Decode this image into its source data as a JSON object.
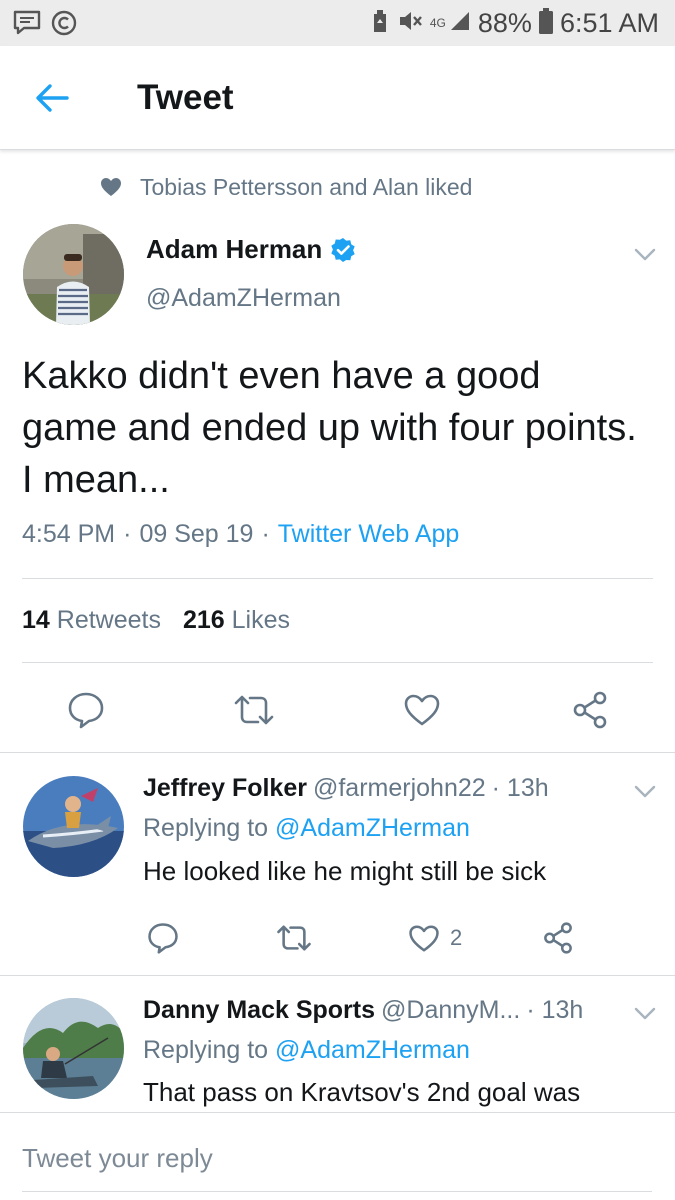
{
  "status_bar": {
    "battery": "88%",
    "time": "6:51 AM",
    "network": "4G"
  },
  "header": {
    "title": "Tweet"
  },
  "social_context": {
    "text": "Tobias Pettersson and Alan liked"
  },
  "main_tweet": {
    "name": "Adam Herman",
    "handle": "@AdamZHerman",
    "text": "Kakko didn't even have a good game and ended up with four points. I mean...",
    "time": "4:54 PM",
    "date": "09 Sep 19",
    "source": "Twitter Web App",
    "separator": "·",
    "retweets_count": "14",
    "retweets_label": "Retweets",
    "likes_count": "216",
    "likes_label": "Likes"
  },
  "replies": [
    {
      "name": "Jeffrey Folker",
      "handle": "@farmerjohn22",
      "time": "· 13h",
      "replying_prefix": "Replying to",
      "replying_to": "@AdamZHerman",
      "text": "He looked like he might still be sick",
      "like_count": "2"
    },
    {
      "name": "Danny Mack Sports",
      "handle": "@DannyM...",
      "time": "· 13h",
      "replying_prefix": "Replying to",
      "replying_to": "@AdamZHerman",
      "text": "That pass on Kravtsov's 2nd goal was"
    }
  ],
  "compose": {
    "placeholder": "Tweet your reply"
  },
  "colors": {
    "accent": "#1da1f2",
    "muted": "#657786",
    "text": "#14171a",
    "divider": "#d9dde0"
  }
}
